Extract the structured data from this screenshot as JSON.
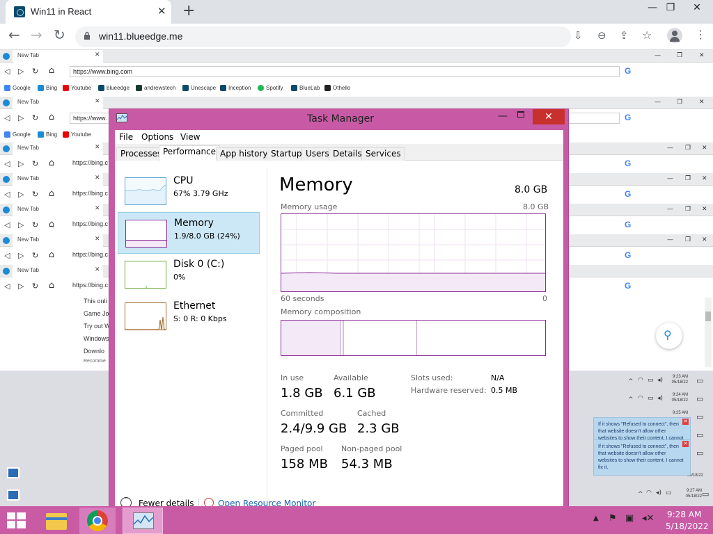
{
  "browser": {
    "tab_title": "Win11 in React",
    "url": "win11.blueedge.me"
  },
  "inner": {
    "tab_title": "New Tab",
    "url": "https://www.bing.com",
    "url_short": "https://www.",
    "url_bing": "https://bing.c",
    "bookmarks": [
      "Google",
      "Bing",
      "Youtube",
      "blueedge",
      "andrewstech",
      "Unescape",
      "Inception",
      "Spotify",
      "BlueLab",
      "Othello"
    ],
    "side_lines": [
      "This onli",
      "Game Jo",
      "Try out W",
      "Windows",
      "Downlo",
      "Recomme"
    ]
  },
  "taskmanager": {
    "title": "Task Manager",
    "menu": [
      "File",
      "Options",
      "View"
    ],
    "tabs": [
      "Processes",
      "Performance",
      "App history",
      "Startup",
      "Users",
      "Details",
      "Services"
    ],
    "active_tab": "Performance",
    "side": [
      {
        "name": "CPU",
        "sub": "67% 3.79 GHz"
      },
      {
        "name": "Memory",
        "sub": "1.9/8.0 GB (24%)"
      },
      {
        "name": "Disk 0 (C:)",
        "sub": "0%"
      },
      {
        "name": "Ethernet",
        "sub": "S: 0 R: 0 Kbps"
      }
    ],
    "heading": "Memory",
    "total": "8.0 GB",
    "usage_label": "Memory usage",
    "usage_max": "8.0 GB",
    "axis_left": "60 seconds",
    "axis_right": "0",
    "composition_label": "Memory composition",
    "stats": {
      "in_use_label": "In use",
      "in_use": "1.8 GB",
      "available_label": "Available",
      "available": "6.1 GB",
      "committed_label": "Committed",
      "committed": "2.4/9.9 GB",
      "cached_label": "Cached",
      "cached": "2.3 GB",
      "paged_label": "Paged pool",
      "paged": "158 MB",
      "nonpaged_label": "Non-paged pool",
      "nonpaged": "54.3 MB",
      "slots_label": "Slots used:",
      "slots": "N/A",
      "hwres_label": "Hardware reserved:",
      "hwres": "0.5 MB"
    },
    "fewer_details": "Fewer details",
    "resource_monitor": "Open Resource Monitor",
    "accent": "#8b2f9a"
  },
  "notifications": [
    {
      "text": "If it shows \"Refused to connect\", then that website doesn't allow other websites to show their content. I cannot fix it."
    },
    {
      "text": "If it shows \"Refused to connect\", then that website doesn't allow other websites to show their content. I cannot fix it."
    }
  ],
  "small_clock": [
    {
      "time": "9:23 AM",
      "date": "05/18/22"
    },
    {
      "time": "9:24 AM",
      "date": "05/18/22"
    },
    {
      "time": "9:25 AM",
      "date": "05/18/22"
    },
    {
      "time": "9:27 AM",
      "date": "05/18/22"
    }
  ],
  "taskbar": {
    "time": "9:28 AM",
    "date": "5/18/2022"
  }
}
